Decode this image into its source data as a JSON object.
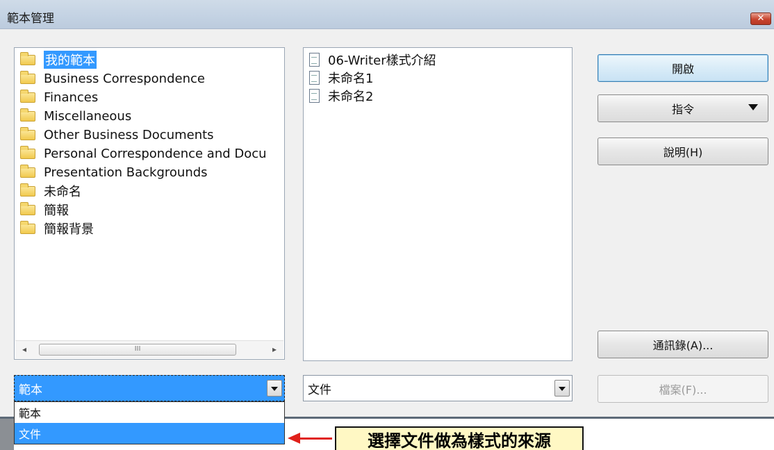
{
  "window": {
    "title": "範本管理",
    "close_label": "✕"
  },
  "left_tree": {
    "items": [
      {
        "label": "我的範本",
        "icon": "folder-icon",
        "selected": true
      },
      {
        "label": "Business Correspondence",
        "icon": "folder-icon"
      },
      {
        "label": "Finances",
        "icon": "folder-icon"
      },
      {
        "label": "Miscellaneous",
        "icon": "folder-icon"
      },
      {
        "label": "Other Business Documents",
        "icon": "folder-icon"
      },
      {
        "label": "Personal Correspondence and Docu",
        "icon": "folder-icon"
      },
      {
        "label": "Presentation Backgrounds",
        "icon": "folder-icon"
      },
      {
        "label": "未命名",
        "icon": "folder-icon"
      },
      {
        "label": "簡報",
        "icon": "folder-icon"
      },
      {
        "label": "簡報背景",
        "icon": "folder-icon"
      }
    ],
    "scroll_left": "◂",
    "scroll_right": "▸",
    "scroll_thumb": "III"
  },
  "mid_list": {
    "items": [
      {
        "label": "06-Writer樣式介紹",
        "icon": "document-icon"
      },
      {
        "label": "未命名1",
        "icon": "document-icon"
      },
      {
        "label": "未命名2",
        "icon": "document-icon"
      }
    ]
  },
  "buttons": {
    "open": "開啟",
    "commands": "指令",
    "help": "說明(H)",
    "address_book": "通訊錄(A)...",
    "file": "檔案(F)..."
  },
  "combos": {
    "left_value": "範本",
    "mid_value": "文件"
  },
  "dropdown": {
    "options": [
      "範本",
      "文件"
    ],
    "active_index": 1
  },
  "annotation": {
    "text": "選擇文件做為樣式的來源",
    "colors": {
      "arrow": "#e0201a",
      "box": "#fff8c4"
    }
  },
  "colors": {
    "selection": "#3399ff",
    "titlebar": "#c3d2e3",
    "close": "#c8452f"
  }
}
